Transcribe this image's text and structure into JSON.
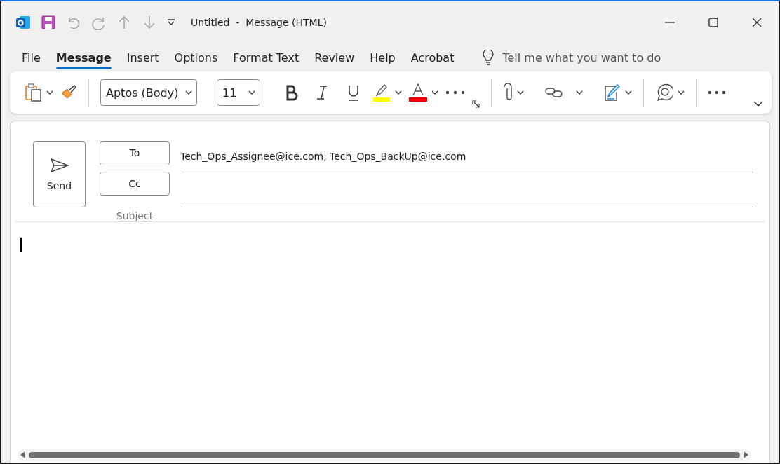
{
  "window": {
    "title": "Untitled  -  Message (HTML)"
  },
  "tabs": [
    {
      "label": "File",
      "selected": false
    },
    {
      "label": "Message",
      "selected": true
    },
    {
      "label": "Insert",
      "selected": false
    },
    {
      "label": "Options",
      "selected": false
    },
    {
      "label": "Format Text",
      "selected": false
    },
    {
      "label": "Review",
      "selected": false
    },
    {
      "label": "Help",
      "selected": false
    },
    {
      "label": "Acrobat",
      "selected": false
    }
  ],
  "search": {
    "placeholder": "Tell me what you want to do"
  },
  "ribbon": {
    "font": "Aptos (Body)",
    "font_size": "11"
  },
  "compose": {
    "send": "Send",
    "to_label": "To",
    "to_value": "Tech_Ops_Assignee@ice.com, Tech_Ops_BackUp@ice.com",
    "cc_label": "Cc",
    "subject_label": "Subject"
  }
}
